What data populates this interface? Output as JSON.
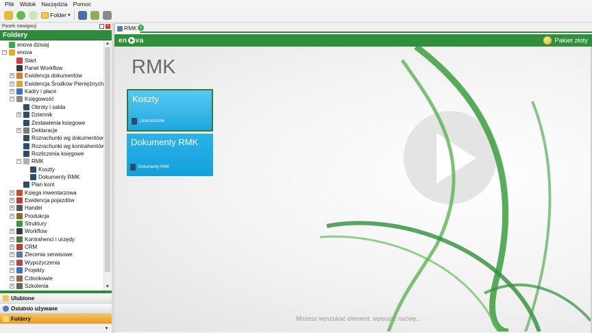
{
  "menu": [
    "Plik",
    "Widok",
    "Narzędzia",
    "Pomoc"
  ],
  "toolbar": {
    "folder_label": "Folder"
  },
  "nav": {
    "header": "Pasek nawigacji",
    "title": "Foldery",
    "tree": [
      {
        "label": "enova dzisiaj",
        "color": "#3aa84a"
      },
      {
        "label": "enova",
        "color": "#e8a92a"
      },
      {
        "label": "Start",
        "color": "#d33c3c"
      },
      {
        "label": "Panel Workflow",
        "color": "#3a3a3a"
      },
      {
        "label": "Ewidencja dokumentów",
        "color": "#d67b2a"
      },
      {
        "label": "Ewidencja Środków Pieniężnych",
        "color": "#d9a43a"
      },
      {
        "label": "Kadry i płace",
        "color": "#3a6fd0"
      },
      {
        "label": "Księgowość",
        "color": "#8a8a8a"
      },
      {
        "label": "Obroty i salda",
        "color": "#2e4d6b"
      },
      {
        "label": "Dziennik",
        "color": "#2e4d6b"
      },
      {
        "label": "Zestawienia księgowe",
        "color": "#2e4d6b"
      },
      {
        "label": "Deklaracje",
        "color": "#7a7a7a"
      },
      {
        "label": "Rozrachunki wg dokumentów",
        "color": "#2e4d6b"
      },
      {
        "label": "Rozrachunki wg kontrahentów",
        "color": "#2e4d6b"
      },
      {
        "label": "Rozliczenia księgowe",
        "color": "#2e4d6b"
      },
      {
        "label": "RMK",
        "color": "#b0b0b0"
      },
      {
        "label": "Koszty",
        "color": "#2e4d6b"
      },
      {
        "label": "Dokumenty RMK",
        "color": "#2e4d6b"
      },
      {
        "label": "Plan kont",
        "color": "#2e4d6b"
      },
      {
        "label": "Księga inwentarzowa",
        "color": "#c2502a"
      },
      {
        "label": "Ewidencja pojazdów",
        "color": "#c23a3a"
      },
      {
        "label": "Handel",
        "color": "#555555"
      },
      {
        "label": "Produkcja",
        "color": "#8a6a2a"
      },
      {
        "label": "Struktury",
        "color": "#3a9a3a"
      },
      {
        "label": "Workflow",
        "color": "#3a3a3a"
      },
      {
        "label": "Kontrahenci i urzędy",
        "color": "#4a7a3a"
      },
      {
        "label": "CRM",
        "color": "#c0392b"
      },
      {
        "label": "Zlecenia serwisowe",
        "color": "#5a7aa0"
      },
      {
        "label": "Wypożyczenia",
        "color": "#c04040"
      },
      {
        "label": "Projekty",
        "color": "#3a6fd0"
      },
      {
        "label": "Członkowie",
        "color": "#8a6a4a"
      },
      {
        "label": "Szkolenia",
        "color": "#666666"
      }
    ],
    "bottom": [
      {
        "label": "Ulubione",
        "color": "#f3c64a"
      },
      {
        "label": "Ostatnio używane",
        "color": "#4a7fb8"
      },
      {
        "label": "Foldery",
        "color": "#f3c64a"
      }
    ]
  },
  "tabs": [
    {
      "label": "RMK"
    }
  ],
  "brand": {
    "logo_left": "en",
    "logo_right": "va",
    "package": "Pakiet złoty"
  },
  "page": {
    "title": "RMK",
    "tiles": [
      {
        "title": "Koszty",
        "link": "Lista kosztów"
      },
      {
        "title": "Dokumenty RMK",
        "link": "Dokumenty RMK"
      }
    ],
    "search_hint": "Możesz wyszukać element, wpisując nazwę..."
  }
}
